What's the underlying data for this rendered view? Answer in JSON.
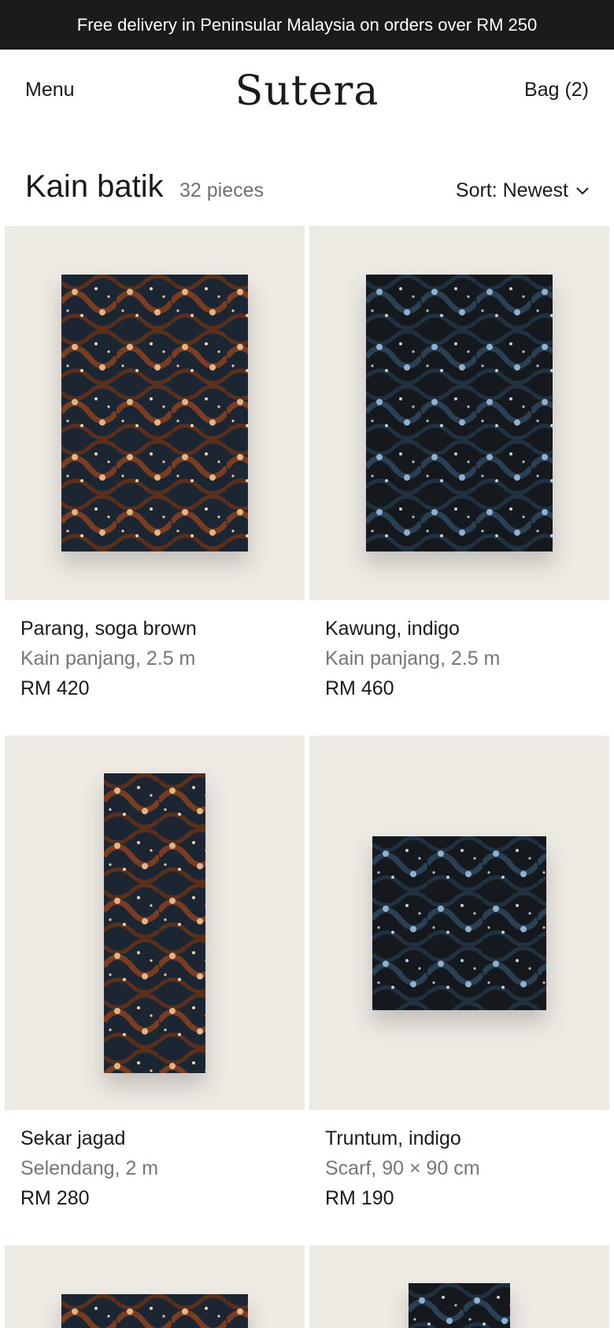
{
  "promo": {
    "text": "Free delivery in Peninsular Malaysia on orders over RM 250"
  },
  "header": {
    "menu_label": "Menu",
    "logo": "Sutera",
    "bag_label": "Bag (2)"
  },
  "listing": {
    "title": "Kain batik",
    "count": "32 pieces",
    "sort_label": "Sort: Newest"
  },
  "products": [
    {
      "name": "Parang, soga brown",
      "desc": "Kain panjang, 2.5 m",
      "price": "RM 420",
      "colorway": "brown"
    },
    {
      "name": "Kawung, indigo",
      "desc": "Kain panjang, 2.5 m",
      "price": "RM 460",
      "colorway": "indigo"
    },
    {
      "name": "Sekar jagad",
      "desc": "Selendang, 2 m",
      "price": "RM 280",
      "colorway": "brown"
    },
    {
      "name": "Truntum, indigo",
      "desc": "Scarf, 90 × 90 cm",
      "price": "RM 190",
      "colorway": "indigo"
    },
    {
      "name": "",
      "desc": "",
      "price": "",
      "colorway": "brown"
    },
    {
      "name": "",
      "desc": "",
      "price": "",
      "colorway": "indigo"
    }
  ],
  "colors": {
    "promo_bg": "#1b1b1b",
    "card_bg": "#ede9e3",
    "muted_text": "#767676"
  }
}
